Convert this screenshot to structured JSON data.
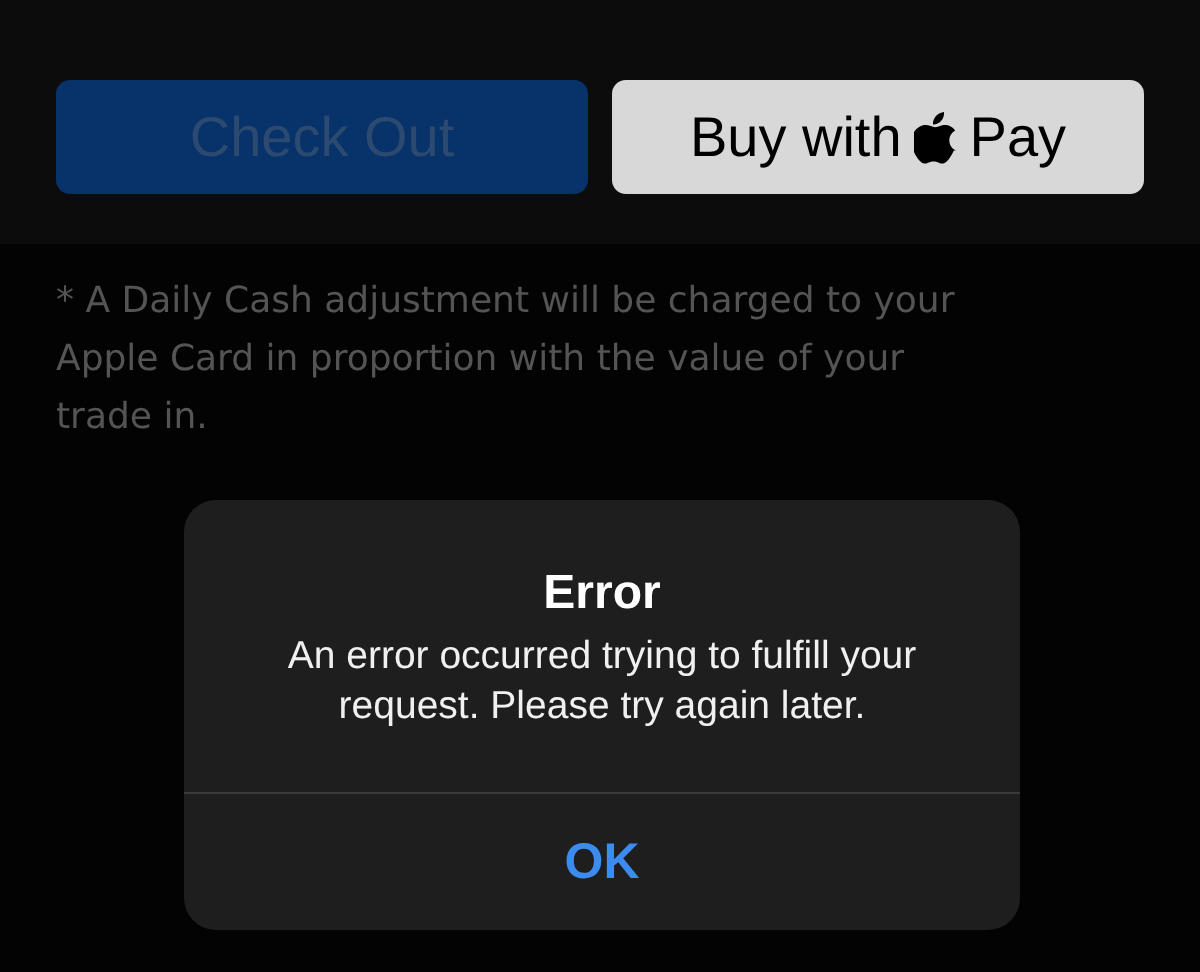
{
  "buttons": [
    {
      "kind": "checkout",
      "label": "Check Out",
      "disabled": true
    },
    {
      "kind": "pay",
      "label_before": "Buy with",
      "label_after": "Pay",
      "disabled": false
    }
  ],
  "footnote": "* A Daily Cash adjustment will be charged to your Apple Card in proportion with the value of your trade in.",
  "alert": {
    "title": "Error",
    "message": "An error occurred trying to fulfill your request. Please try again later.",
    "button": "OK"
  }
}
